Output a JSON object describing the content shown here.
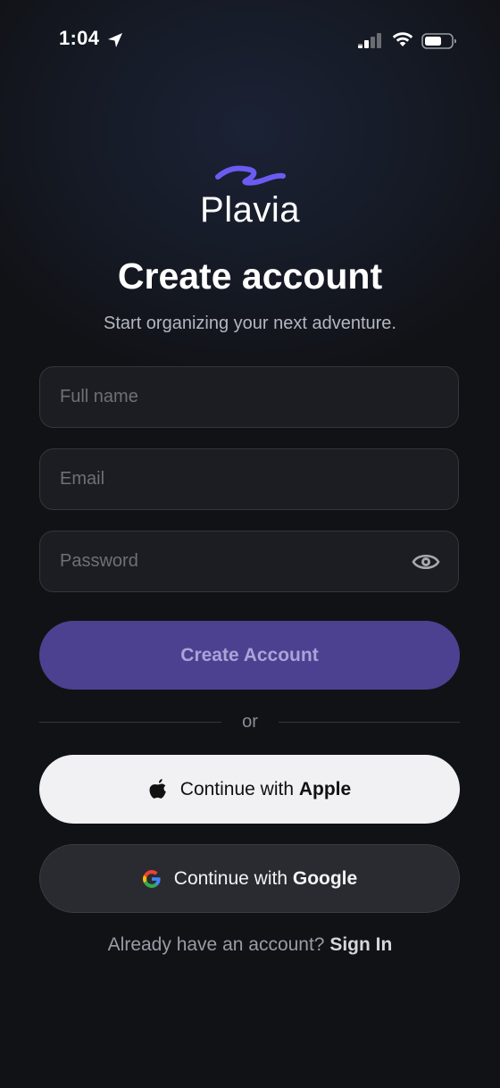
{
  "status_bar": {
    "time": "1:04"
  },
  "brand": {
    "name": "Plavia",
    "accent_color": "#6a5cf2"
  },
  "header": {
    "title": "Create account",
    "subtitle": "Start organizing your next adventure."
  },
  "form": {
    "full_name": {
      "placeholder": "Full name",
      "value": ""
    },
    "email": {
      "placeholder": "Email",
      "value": ""
    },
    "password": {
      "placeholder": "Password",
      "value": ""
    },
    "submit_label": "Create Account"
  },
  "divider": {
    "label": "or"
  },
  "social": {
    "apple": {
      "prefix": "Continue with ",
      "provider": "Apple"
    },
    "google": {
      "prefix": "Continue with ",
      "provider": "Google"
    }
  },
  "footer": {
    "prompt": "Already have an account? ",
    "link": "Sign In"
  },
  "icons": {
    "status": [
      "location-arrow-icon",
      "cellular-signal-icon",
      "wifi-icon",
      "battery-icon"
    ],
    "password_toggle": "eye-icon",
    "apple": "apple-logo-icon",
    "google": "google-logo-icon"
  }
}
